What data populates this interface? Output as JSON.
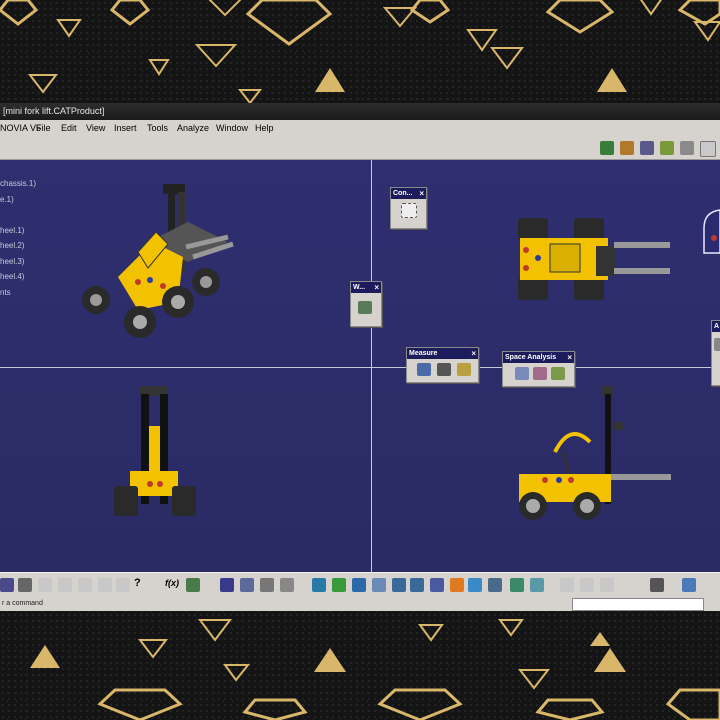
{
  "window": {
    "title": "[mini fork lift.CATProduct]"
  },
  "menu": {
    "app": "NOVIA V5",
    "items": [
      "File",
      "Edit",
      "View",
      "Insert",
      "Tools",
      "Analyze",
      "Window",
      "Help"
    ]
  },
  "tree": {
    "items": [
      "chassis.1)",
      "e.1)",
      "heel.1)",
      "heel.2)",
      "heel.3)",
      "heel.4)",
      "nts"
    ]
  },
  "panels": {
    "con_title": "Con...",
    "w_title": "W...",
    "measure_title": "Measure",
    "space_title": "Space Analysis",
    "a_title": "A",
    "close": "×"
  },
  "status": {
    "prompt": "r a command"
  },
  "bottom": {
    "fog_label": "f(x)",
    "help_label": "?"
  },
  "colors": {
    "viewport": "#2c2c6a",
    "lego_yellow": "#f2c200",
    "panel_header": "#1c1c5c",
    "gold": "#d9b76a"
  }
}
